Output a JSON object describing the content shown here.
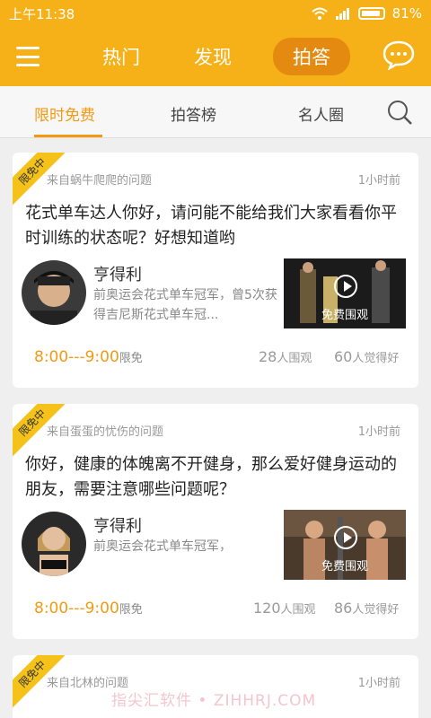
{
  "statusbar": {
    "time": "上午11:38",
    "battery": "81%"
  },
  "topbar": {
    "tabs": [
      "热门",
      "发现",
      "拍答"
    ],
    "active_tab": "拍答"
  },
  "subtabs": {
    "items": [
      "限时免费",
      "拍答榜",
      "名人圈"
    ]
  },
  "cards": [
    {
      "ribbon": "限免中",
      "from": "来自蜗牛爬爬的问题",
      "time": "1小时前",
      "question": "花式单车达人你好，请问能不能给我们大家看看你平时训练的状态呢？好想知道哟",
      "answerer_name": "亨得利",
      "answerer_desc": "前奥运会花式单车冠军，曾5次获得吉尼斯花式单车冠...",
      "video_label": "免费围观",
      "time_range": "8:00---9:00",
      "free_label": "限免",
      "watch_count": "28",
      "watch_label": "人围观",
      "like_count": "60",
      "like_label": "人觉得好"
    },
    {
      "ribbon": "限免中",
      "from": "来自蛋蛋的忧伤的问题",
      "time": "1小时前",
      "question": "你好，健康的体魄离不开健身，那么爱好健身运动的朋友，需要注意哪些问题呢？",
      "answerer_name": "亨得利",
      "answerer_desc": "前奥运会花式单车冠军，",
      "video_label": "免费围观",
      "time_range": "8:00---9:00",
      "free_label": "限免",
      "watch_count": "120",
      "watch_label": "人围观",
      "like_count": "86",
      "like_label": "人觉得好"
    },
    {
      "ribbon": "限免中",
      "from": "来自北林的问题",
      "time": "1小时前"
    }
  ],
  "watermark": "指尖汇软件 • ZIHHRJ.COM",
  "colors": {
    "accent": "#f5b117",
    "accent_dark": "#e58a10",
    "highlight": "#f29a14"
  }
}
